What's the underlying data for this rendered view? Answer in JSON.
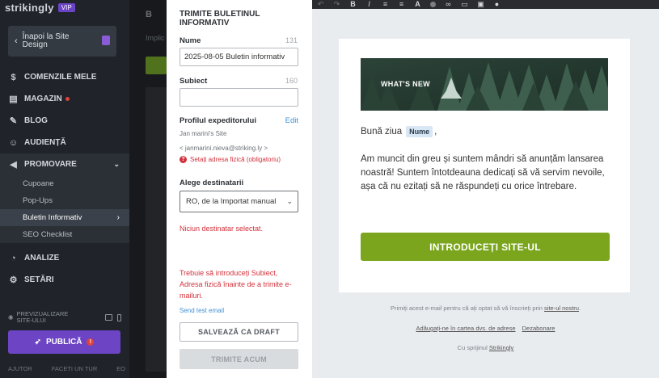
{
  "brand": {
    "logo": "strikingly",
    "vip": "VIP"
  },
  "sidebar": {
    "back_label": "Înapoi la Site Design",
    "items": [
      {
        "label": "COMENZILE MELE",
        "icon": "dollar-icon"
      },
      {
        "label": "MAGAZIN",
        "icon": "store-icon"
      },
      {
        "label": "BLOG",
        "icon": "pen-icon"
      },
      {
        "label": "AUDIENȚĂ",
        "icon": "people-icon"
      },
      {
        "label": "PROMOVARE",
        "icon": "megaphone-icon"
      }
    ],
    "sub_items": [
      "Cupoane",
      "Pop-Ups",
      "Buletin Informativ",
      "SEO Checklist"
    ],
    "items_after": [
      {
        "label": "ANALIZE",
        "icon": "chart-icon"
      },
      {
        "label": "SETĂRI",
        "icon": "gear-icon"
      }
    ],
    "preview_label": "PREVIZUALIZARE SITE-ULUI",
    "publish_label": "PUBLICĂ",
    "publish_badge": "!",
    "footer": [
      "AJUTOR",
      "FACETI UN TUR",
      "EO"
    ]
  },
  "backdrop": {
    "title": "B",
    "subtitle": "Implic"
  },
  "form": {
    "title": "TRIMITE BULETINUL INFORMATIV",
    "name_label": "Nume",
    "name_count": "131",
    "name_value": "2025-08-05 Buletin informativ",
    "subject_label": "Subiect",
    "subject_count": "160",
    "subject_value": "",
    "sender_label": "Profilul expeditorului",
    "edit_label": "Edit",
    "sender_name": "Jan marini's Site",
    "sender_email": "< janmarini.nieva@striking.ly >",
    "address_warning": "Setați adresa fizică (obligatoriu)",
    "recipients_label": "Alege destinatarii",
    "recipients_value": "RO, de la Importat manual",
    "recipients_error": "Niciun destinatar selectat.",
    "general_error": "Trebuie să introduceți Subiect, Adresa fizică înainte de a trimite e-mailuri.",
    "send_test_label": "Send test email",
    "save_draft_label": "SALVEAZĂ CA DRAFT",
    "send_now_label": "TRIMITE ACUM"
  },
  "email": {
    "hero_text": "WHAT'S NEW",
    "greeting": "Bună ziua",
    "name_tag": "Nume",
    "greeting_suffix": ",",
    "body": "Am muncit din greu și suntem mândri să anunțăm lansarea noastră! Suntem întotdeauna dedicați să vă servim nevoile, așa că nu ezitați să ne răspundeți cu orice întrebare.",
    "cta_label": "INTRODUCEȚI SITE-UL",
    "footer_text": "Primiți acest e-mail pentru că ați optat să vă înscrieți prin",
    "footer_link": "site-ul nostru",
    "footer_end": ".",
    "add_address_link": "Adăugați-ne în cartea dvs. de adrese",
    "unsubscribe_link": "Dezabonare",
    "powered_text": "Cu sprijinul",
    "powered_link": "Strikingly"
  },
  "colors": {
    "sidebar_bg": "#20242a",
    "publish": "#6c44c4",
    "cta_green": "#7aa51c",
    "error_red": "#d2313c",
    "link_blue": "#3f91d4"
  }
}
